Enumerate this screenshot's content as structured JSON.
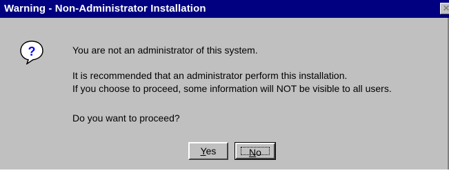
{
  "window": {
    "title": "Warning - Non-Administrator Installation",
    "close_symbol": "✕"
  },
  "icon": "question-mark-icon",
  "message": {
    "line1": "You are not an administrator of this system.",
    "line2": "It is recommended that an administrator perform this installation.",
    "line3": "If you choose to proceed, some information will NOT be visible to all users.",
    "line4": "Do you want to proceed?"
  },
  "buttons": {
    "yes_mnemonic": "Y",
    "yes_rest": "es",
    "no_mnemonic": "N",
    "no_rest": "o"
  },
  "colors": {
    "titlebar": "#000080",
    "face": "#c0c0c0"
  }
}
